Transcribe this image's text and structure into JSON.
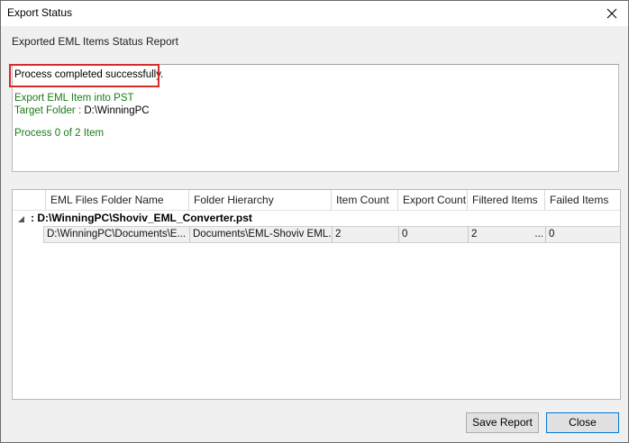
{
  "window": {
    "title": "Export Status"
  },
  "header": {
    "subtitle": "Exported EML Items Status Report"
  },
  "log": {
    "status": "Process completed successfully.",
    "task": "Export EML Item into PST",
    "target_label": "Target Folder :",
    "target_value": "D:\\WinningPC",
    "progress": "Process 0 of 2 Item"
  },
  "grid": {
    "columns": [
      "EML Files Folder Name",
      "Folder Hierarchy",
      "Item Count",
      "Export Count",
      "Filtered Items",
      "Failed Items"
    ],
    "group": {
      "label": ": D:\\WinningPC\\Shoviv_EML_Converter.pst"
    },
    "rows": [
      {
        "folder": "D:\\WinningPC\\Documents\\E...",
        "hierarchy": "Documents\\EML-Shoviv EML...",
        "item_count": "2",
        "export_count": "0",
        "filtered": "2",
        "filtered_more": "...",
        "failed": "0"
      }
    ]
  },
  "buttons": {
    "save_report": "Save Report",
    "close": "Close"
  },
  "colors": {
    "highlight": "#d62b2b",
    "log_green": "#1a7a1a",
    "focus_border": "#0078d7"
  },
  "icons": {
    "close": "close-icon",
    "expand": "collapse-toggle-icon"
  }
}
